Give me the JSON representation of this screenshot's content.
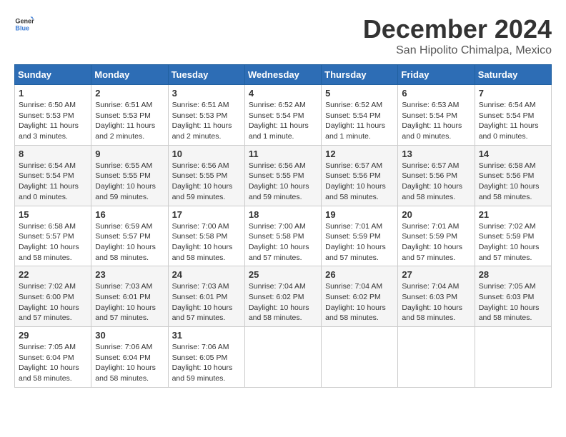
{
  "header": {
    "logo_general": "General",
    "logo_blue": "Blue",
    "month_title": "December 2024",
    "location": "San Hipolito Chimalpa, Mexico"
  },
  "days_of_week": [
    "Sunday",
    "Monday",
    "Tuesday",
    "Wednesday",
    "Thursday",
    "Friday",
    "Saturday"
  ],
  "weeks": [
    [
      {
        "day": "1",
        "sunrise": "6:50 AM",
        "sunset": "5:53 PM",
        "daylight": "11 hours and 3 minutes."
      },
      {
        "day": "2",
        "sunrise": "6:51 AM",
        "sunset": "5:53 PM",
        "daylight": "11 hours and 2 minutes."
      },
      {
        "day": "3",
        "sunrise": "6:51 AM",
        "sunset": "5:53 PM",
        "daylight": "11 hours and 2 minutes."
      },
      {
        "day": "4",
        "sunrise": "6:52 AM",
        "sunset": "5:54 PM",
        "daylight": "11 hours and 1 minute."
      },
      {
        "day": "5",
        "sunrise": "6:52 AM",
        "sunset": "5:54 PM",
        "daylight": "11 hours and 1 minute."
      },
      {
        "day": "6",
        "sunrise": "6:53 AM",
        "sunset": "5:54 PM",
        "daylight": "11 hours and 0 minutes."
      },
      {
        "day": "7",
        "sunrise": "6:54 AM",
        "sunset": "5:54 PM",
        "daylight": "11 hours and 0 minutes."
      }
    ],
    [
      {
        "day": "8",
        "sunrise": "6:54 AM",
        "sunset": "5:54 PM",
        "daylight": "11 hours and 0 minutes."
      },
      {
        "day": "9",
        "sunrise": "6:55 AM",
        "sunset": "5:55 PM",
        "daylight": "10 hours and 59 minutes."
      },
      {
        "day": "10",
        "sunrise": "6:56 AM",
        "sunset": "5:55 PM",
        "daylight": "10 hours and 59 minutes."
      },
      {
        "day": "11",
        "sunrise": "6:56 AM",
        "sunset": "5:55 PM",
        "daylight": "10 hours and 59 minutes."
      },
      {
        "day": "12",
        "sunrise": "6:57 AM",
        "sunset": "5:56 PM",
        "daylight": "10 hours and 58 minutes."
      },
      {
        "day": "13",
        "sunrise": "6:57 AM",
        "sunset": "5:56 PM",
        "daylight": "10 hours and 58 minutes."
      },
      {
        "day": "14",
        "sunrise": "6:58 AM",
        "sunset": "5:56 PM",
        "daylight": "10 hours and 58 minutes."
      }
    ],
    [
      {
        "day": "15",
        "sunrise": "6:58 AM",
        "sunset": "5:57 PM",
        "daylight": "10 hours and 58 minutes."
      },
      {
        "day": "16",
        "sunrise": "6:59 AM",
        "sunset": "5:57 PM",
        "daylight": "10 hours and 58 minutes."
      },
      {
        "day": "17",
        "sunrise": "7:00 AM",
        "sunset": "5:58 PM",
        "daylight": "10 hours and 58 minutes."
      },
      {
        "day": "18",
        "sunrise": "7:00 AM",
        "sunset": "5:58 PM",
        "daylight": "10 hours and 57 minutes."
      },
      {
        "day": "19",
        "sunrise": "7:01 AM",
        "sunset": "5:59 PM",
        "daylight": "10 hours and 57 minutes."
      },
      {
        "day": "20",
        "sunrise": "7:01 AM",
        "sunset": "5:59 PM",
        "daylight": "10 hours and 57 minutes."
      },
      {
        "day": "21",
        "sunrise": "7:02 AM",
        "sunset": "5:59 PM",
        "daylight": "10 hours and 57 minutes."
      }
    ],
    [
      {
        "day": "22",
        "sunrise": "7:02 AM",
        "sunset": "6:00 PM",
        "daylight": "10 hours and 57 minutes."
      },
      {
        "day": "23",
        "sunrise": "7:03 AM",
        "sunset": "6:01 PM",
        "daylight": "10 hours and 57 minutes."
      },
      {
        "day": "24",
        "sunrise": "7:03 AM",
        "sunset": "6:01 PM",
        "daylight": "10 hours and 57 minutes."
      },
      {
        "day": "25",
        "sunrise": "7:04 AM",
        "sunset": "6:02 PM",
        "daylight": "10 hours and 58 minutes."
      },
      {
        "day": "26",
        "sunrise": "7:04 AM",
        "sunset": "6:02 PM",
        "daylight": "10 hours and 58 minutes."
      },
      {
        "day": "27",
        "sunrise": "7:04 AM",
        "sunset": "6:03 PM",
        "daylight": "10 hours and 58 minutes."
      },
      {
        "day": "28",
        "sunrise": "7:05 AM",
        "sunset": "6:03 PM",
        "daylight": "10 hours and 58 minutes."
      }
    ],
    [
      {
        "day": "29",
        "sunrise": "7:05 AM",
        "sunset": "6:04 PM",
        "daylight": "10 hours and 58 minutes."
      },
      {
        "day": "30",
        "sunrise": "7:06 AM",
        "sunset": "6:04 PM",
        "daylight": "10 hours and 58 minutes."
      },
      {
        "day": "31",
        "sunrise": "7:06 AM",
        "sunset": "6:05 PM",
        "daylight": "10 hours and 59 minutes."
      },
      null,
      null,
      null,
      null
    ]
  ],
  "labels": {
    "sunrise": "Sunrise:",
    "sunset": "Sunset:",
    "daylight": "Daylight:"
  }
}
